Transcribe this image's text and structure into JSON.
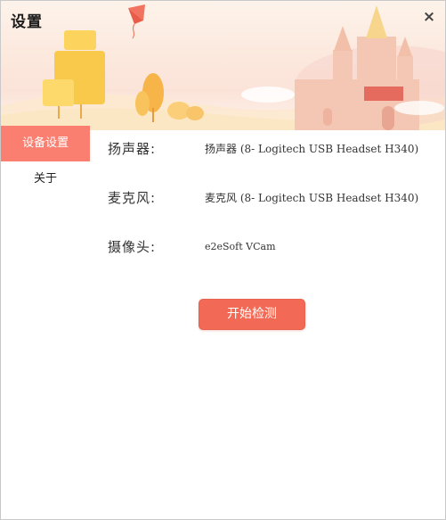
{
  "window": {
    "title": "设置",
    "close_glyph": "×"
  },
  "sidebar": {
    "items": [
      {
        "label": "设备设置",
        "active": true
      },
      {
        "label": "关于",
        "active": false
      }
    ]
  },
  "devices": {
    "speaker": {
      "label": "扬声器:",
      "value": "扬声器 (8- Logitech USB Headset H340)"
    },
    "microphone": {
      "label": "麦克风:",
      "value": "麦克风 (8- Logitech USB Headset H340)"
    },
    "camera": {
      "label": "摄像头:",
      "value": "e2eSoft VCam"
    }
  },
  "actions": {
    "start_test_label": "开始检测"
  },
  "colors": {
    "accent": "#fa7f71",
    "button": "#f26a55"
  }
}
